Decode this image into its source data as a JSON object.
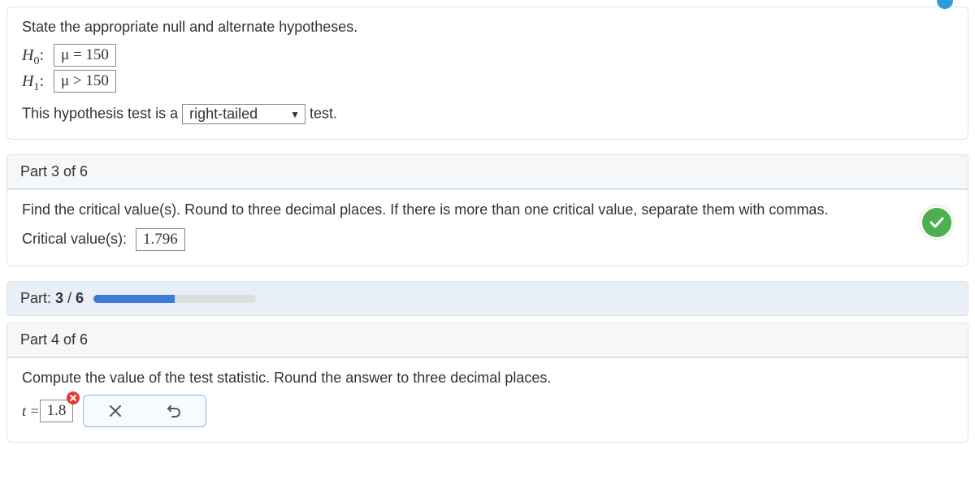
{
  "top": {
    "prompt": "State the appropriate null and alternate hypotheses.",
    "h0_label": "H",
    "h0_sub": "0",
    "h0_value": "μ = 150",
    "h1_label": "H",
    "h1_sub": "1",
    "h1_value": "μ > 150",
    "sentence_pre": "This hypothesis test is a ",
    "tail_select": "right-tailed",
    "sentence_post": " test."
  },
  "part3": {
    "header": "Part 3 of 6",
    "prompt": "Find the critical value(s). Round to three decimal places. If there is more than one critical value, separate them with commas.",
    "cv_label": "Critical value(s): ",
    "cv_value": "1.796"
  },
  "progress": {
    "label_pre": "Part: ",
    "current": "3",
    "sep": " / ",
    "total": "6"
  },
  "part4": {
    "header": "Part 4 of 6",
    "prompt": "Compute the value of the test statistic. Round the answer to three decimal places.",
    "t_pre": "t = ",
    "t_value": "1.8"
  }
}
